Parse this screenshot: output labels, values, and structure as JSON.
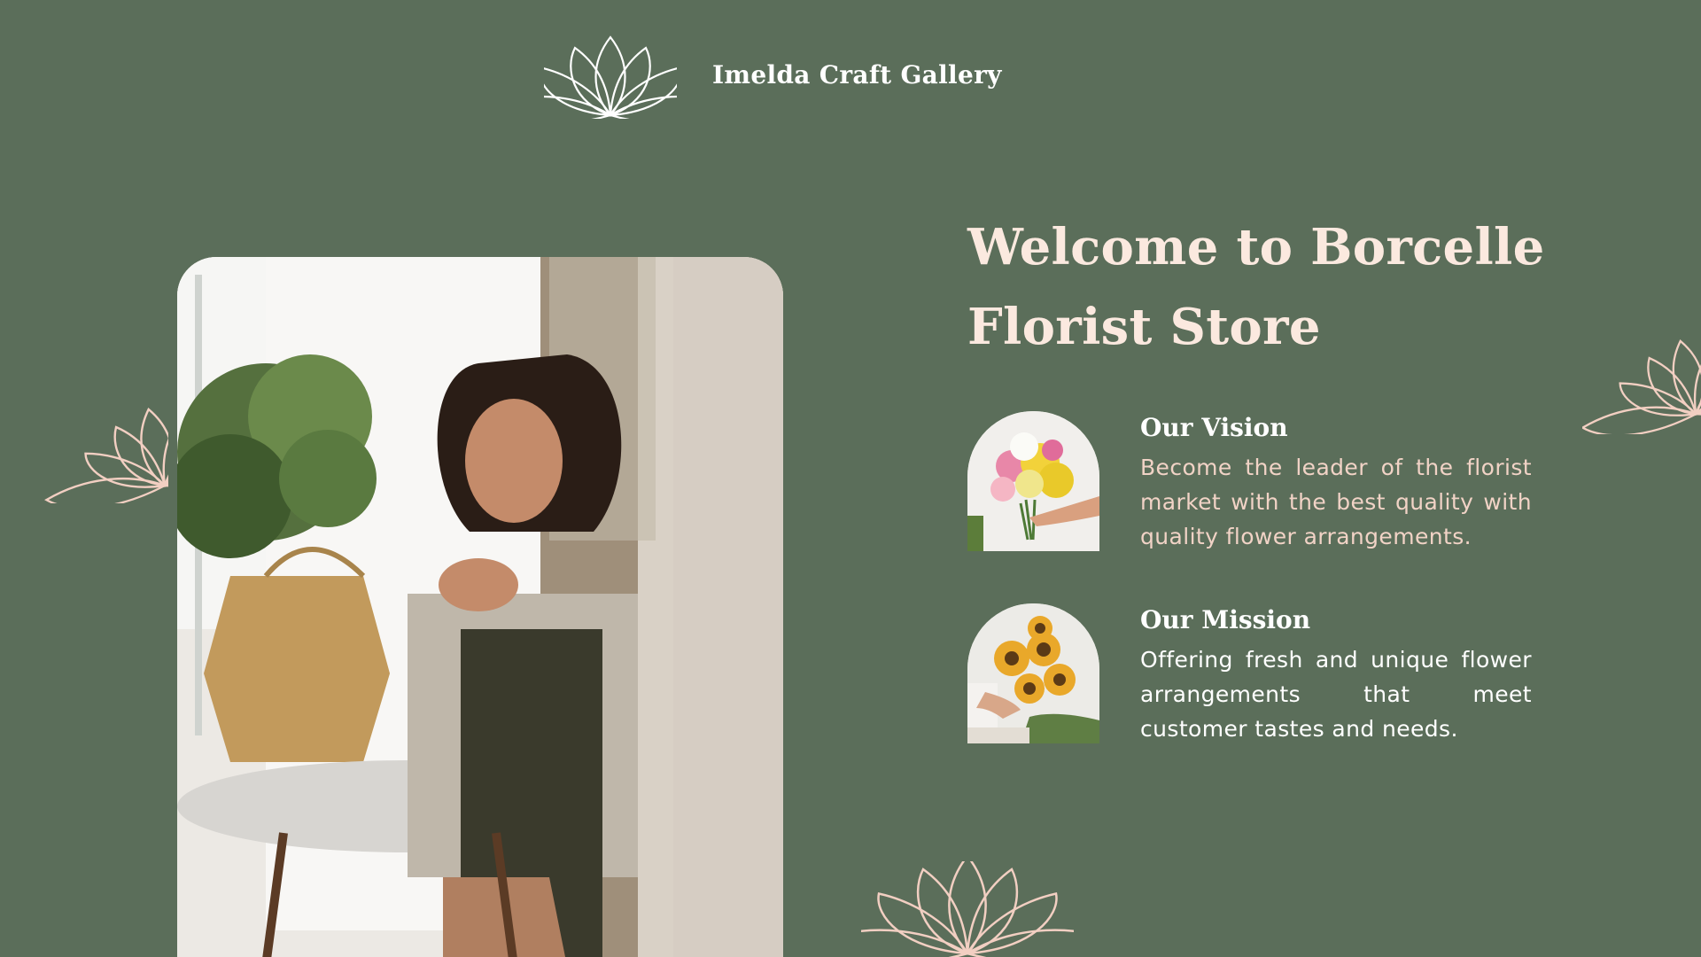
{
  "brand": {
    "name": "Imelda Craft Gallery",
    "logo_icon": "lotus-icon"
  },
  "hero": {
    "title": "Welcome to Borcelle Florist Store",
    "photo": "woman-with-plant-photo"
  },
  "features": [
    {
      "heading": "Our Vision",
      "text": "Become the leader of the florist market with the best quality with quality flower arrangements.",
      "thumbnail": "flower-bouquet-photo"
    },
    {
      "heading": "Our Mission",
      "text": "Offering fresh and unique flower arrangements that meet customer tastes and needs.",
      "thumbnail": "sunflower-bouquet-photo"
    }
  ],
  "colors": {
    "background": "#5b6e5a",
    "title": "#fbe9df",
    "accent_pink": "#f2cfc2",
    "white": "#ffffff"
  }
}
